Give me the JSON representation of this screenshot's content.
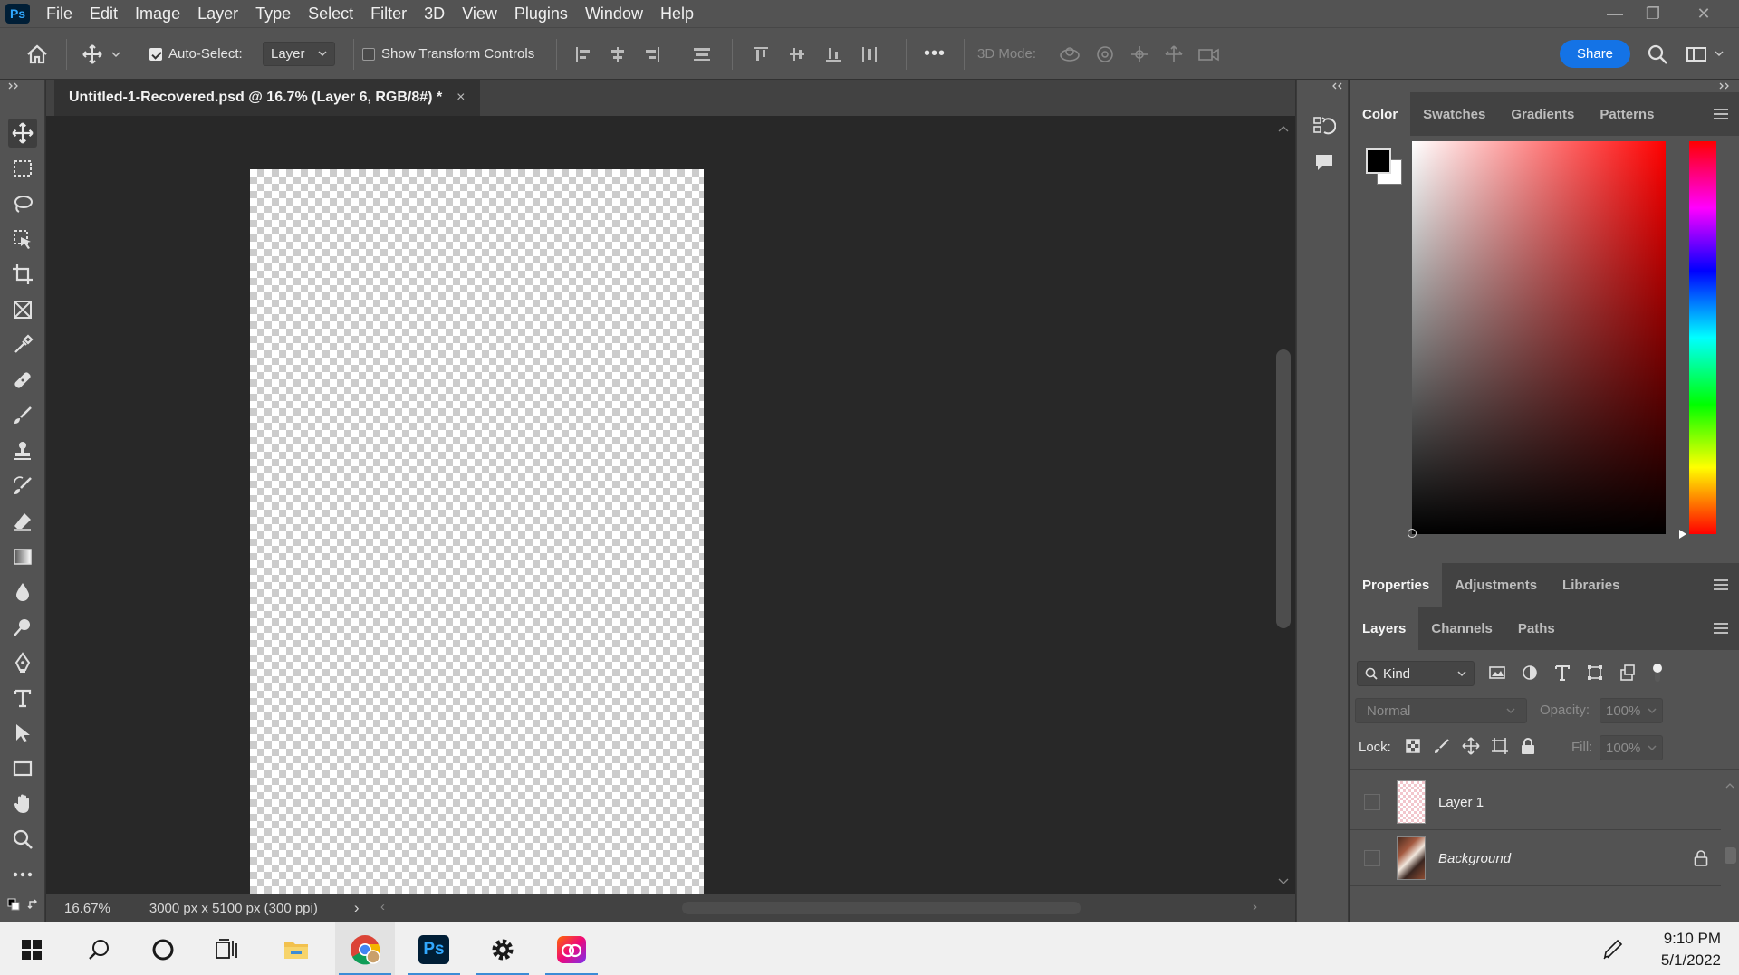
{
  "app": {
    "logo_text": "Ps",
    "menu": [
      "File",
      "Edit",
      "Image",
      "Layer",
      "Type",
      "Select",
      "Filter",
      "3D",
      "View",
      "Plugins",
      "Window",
      "Help"
    ]
  },
  "window_controls": {
    "minimize": "—",
    "restore": "❐",
    "close": "✕"
  },
  "options_bar": {
    "auto_select_label": "Auto-Select:",
    "auto_select_checked": true,
    "auto_select_target": "Layer",
    "show_transform_label": "Show Transform Controls",
    "mode_3d_label": "3D Mode:",
    "more_label": "•••",
    "share_label": "Share"
  },
  "document": {
    "tab_title": "Untitled-1-Recovered.psd @ 16.7% (Layer 6, RGB/8#) *",
    "close_glyph": "×"
  },
  "status_bar": {
    "zoom": "16.67%",
    "doc_info": "3000 px x 5100 px (300 ppi)",
    "arrow": "›",
    "left_arrow": "‹",
    "right_arrow": "›"
  },
  "color_panel": {
    "tabs": [
      "Color",
      "Swatches",
      "Gradients",
      "Patterns"
    ],
    "active_tab": 0,
    "foreground": "#000000",
    "background": "#ffffff"
  },
  "properties_panel": {
    "tabs": [
      "Properties",
      "Adjustments",
      "Libraries"
    ],
    "active_tab": 0
  },
  "layers_panel": {
    "tabs": [
      "Layers",
      "Channels",
      "Paths"
    ],
    "active_tab": 0,
    "filter_kind": "Kind",
    "blend_mode": "Normal",
    "opacity_label": "Opacity:",
    "opacity_value": "100%",
    "lock_label": "Lock:",
    "fill_label": "Fill:",
    "fill_value": "100%",
    "layers": [
      {
        "name": "Layer 1",
        "locked": false
      },
      {
        "name": "Background",
        "locked": true
      }
    ]
  },
  "taskbar": {
    "time": "9:10 PM",
    "date": "5/1/2022",
    "ps_label": "Ps"
  }
}
